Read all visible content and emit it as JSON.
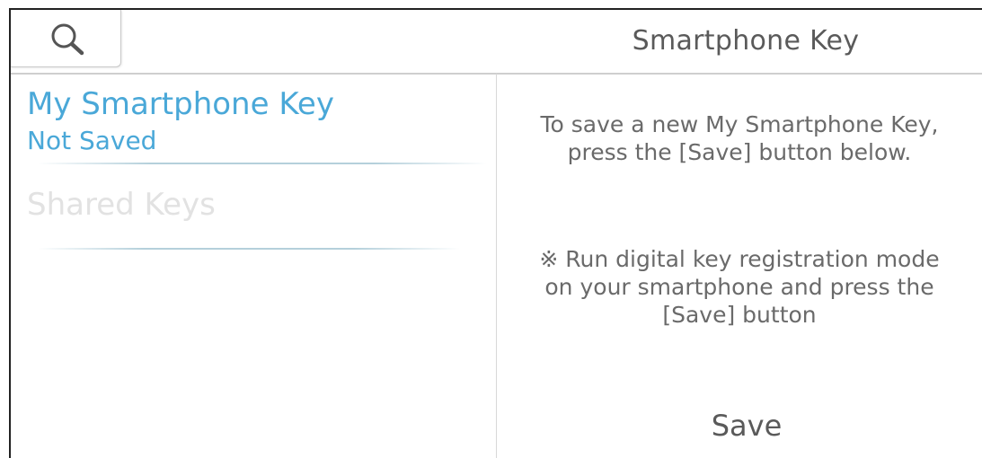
{
  "header": {
    "title": "Smartphone Key",
    "search_icon": "search-icon"
  },
  "sidebar": {
    "items": [
      {
        "label": "My Smartphone Key",
        "status": "Not Saved",
        "state": "selected"
      },
      {
        "label": "Shared Keys",
        "state": "disabled"
      }
    ]
  },
  "main": {
    "instruction": "To save a new My Smartphone Key,\npress the [Save] button below.",
    "note": "※ Run digital key registration mode\non your smartphone and press the\n[Save] button",
    "save_label": "Save"
  },
  "colors": {
    "accent": "#4aa8d8",
    "text": "#5a5a5a",
    "disabled": "#e2e2e2"
  }
}
